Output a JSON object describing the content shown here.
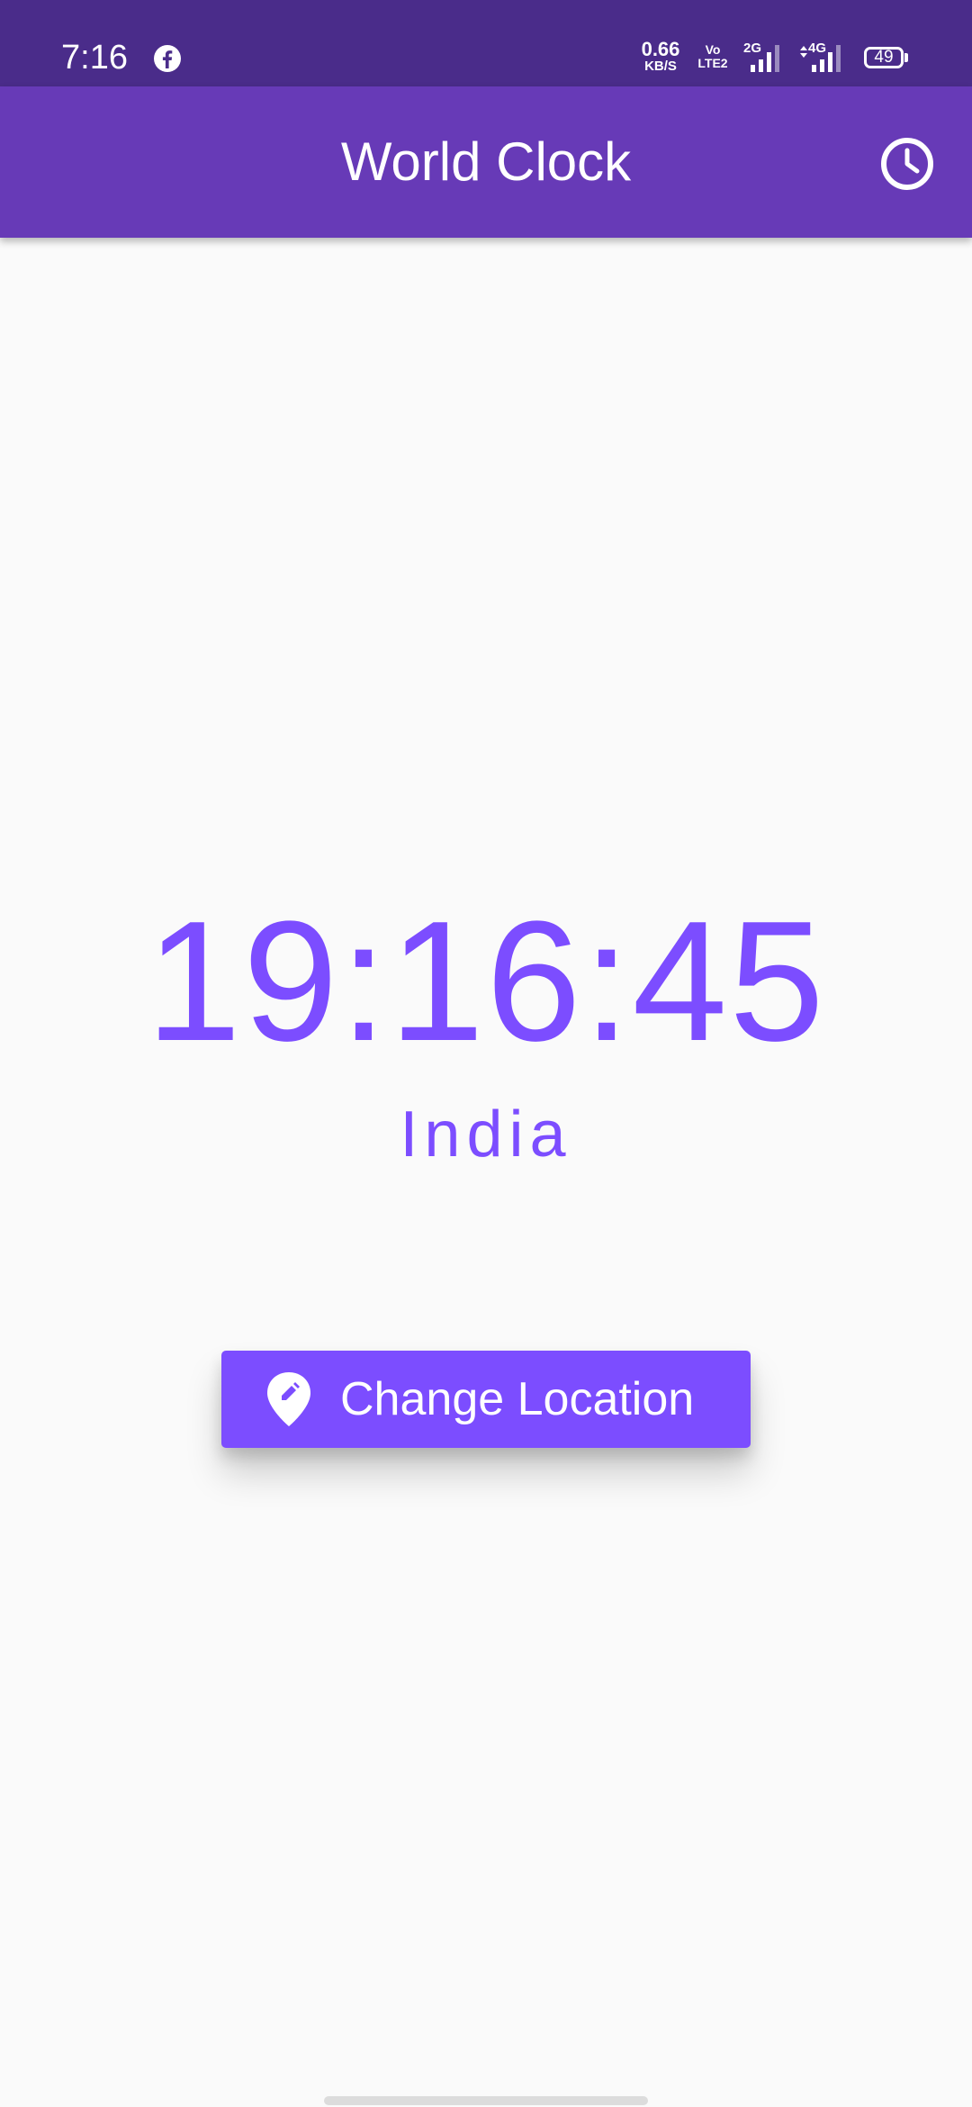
{
  "status_bar": {
    "time": "7:16",
    "net_speed_value": "0.66",
    "net_speed_unit": "KB/S",
    "volte_top": "Vo",
    "volte_bottom": "LTE2",
    "sim1_network": "2G",
    "sim2_network": "4G",
    "battery_level": "49"
  },
  "app_bar": {
    "title": "World Clock",
    "action_icon": "clock-icon"
  },
  "clock": {
    "time": "19:16:45",
    "location": "India"
  },
  "actions": {
    "change_location_label": "Change Location",
    "change_location_icon": "edit-location-icon"
  },
  "colors": {
    "status_bar": "#4a2c8a",
    "app_bar": "#673ab7",
    "accent": "#7c4dff",
    "background": "#fafafa"
  }
}
